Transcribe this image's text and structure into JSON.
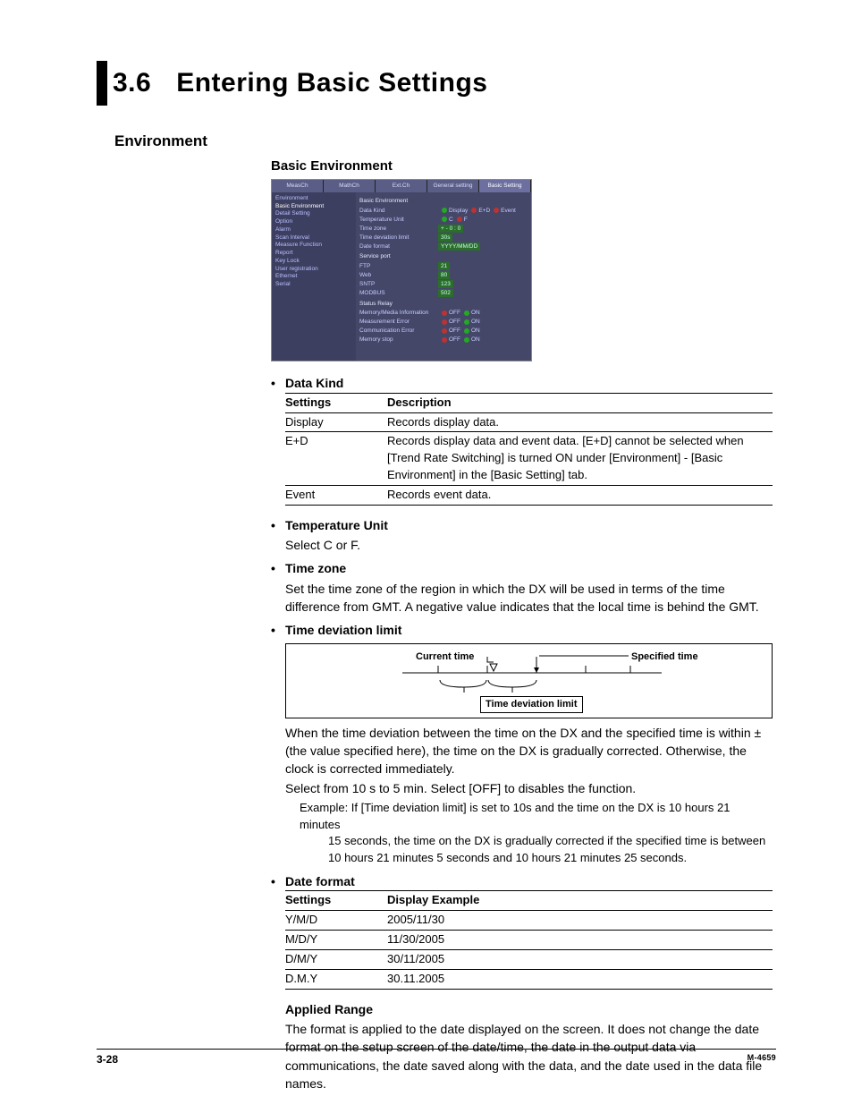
{
  "chapter": {
    "num": "3.6",
    "title": "Entering Basic Settings"
  },
  "h2_env": "Environment",
  "h3_basic_env": "Basic Environment",
  "screenshot": {
    "tabs": [
      "MeasCh",
      "MathCh",
      "Ext.Ch",
      "General setting",
      "Basic Setting"
    ],
    "nav": [
      "Environment",
      "Basic Environment",
      "Detail Setting",
      "Option",
      "Alarm",
      "Scan Interval",
      "Measure Function",
      "Report",
      "Key Lock",
      "User registration",
      "Ethernet",
      "Serial"
    ],
    "panel_title": "Basic Environment",
    "rows_env": [
      {
        "label": "Data Kind",
        "opts": [
          "Display",
          "E+D",
          "Event"
        ]
      },
      {
        "label": "Temperature Unit",
        "opts": [
          "C",
          "F"
        ]
      },
      {
        "label": "Time zone",
        "val": "+  -  0  :  0"
      },
      {
        "label": "Time deviation limit",
        "val": "30s"
      },
      {
        "label": "Date format",
        "val": "YYYY/MM/DD"
      }
    ],
    "section_service": "Service port",
    "rows_service": [
      {
        "label": "FTP",
        "val": "21"
      },
      {
        "label": "Web",
        "val": "80"
      },
      {
        "label": "SNTP",
        "val": "123"
      },
      {
        "label": "MODBUS",
        "val": "502"
      }
    ],
    "section_relay": "Status Relay",
    "rows_relay": [
      {
        "label": "Memory/Media Information",
        "opts": [
          "OFF",
          "ON"
        ]
      },
      {
        "label": "Measurement Error",
        "opts": [
          "OFF",
          "ON"
        ]
      },
      {
        "label": "Communication Error",
        "opts": [
          "OFF",
          "ON"
        ]
      },
      {
        "label": "Memory stop",
        "opts": [
          "OFF",
          "ON"
        ]
      }
    ]
  },
  "bullets": {
    "data_kind": "Data Kind",
    "temp_unit_h": "Temperature Unit",
    "temp_unit_t": "Select C or F.",
    "tz_h": "Time zone",
    "tz_t": "Set the time zone of the region in which the DX will be used in terms of the time difference from GMT.  A negative value indicates that the local time is behind the GMT.",
    "tdl_h": "Time deviation limit",
    "tdl_p1": "When the time deviation between the time on the DX and the specified time is within ±(the value specified here), the time on the DX is gradually corrected.  Otherwise, the clock is corrected immediately.",
    "tdl_p2": "Select from 10 s to 5 min.  Select [OFF] to disables the function.",
    "tdl_ex1": "Example:  If [Time deviation limit] is set to 10s and the time on the DX is 10 hours 21 minutes",
    "tdl_ex2": "15 seconds, the time on the DX is gradually corrected if the specified time is between",
    "tdl_ex3": "10 hours 21 minutes 5 seconds and 10 hours 21 minutes 25 seconds.",
    "df_h": "Date format",
    "ar_h": "Applied Range",
    "ar_t": "The format is applied to the date displayed on the screen.  It does not change the date format on the setup screen of the date/time, the date in the output data via communications, the date saved along with the data, and the date used in the data file names."
  },
  "diagram": {
    "ct": "Current time",
    "st": "Specified time",
    "box": "Time deviation limit"
  },
  "table_dk": {
    "head": [
      "Settings",
      "Description"
    ],
    "rows": [
      [
        "Display",
        "Records display data."
      ],
      [
        "E+D",
        "Records display data and event data.   [E+D] cannot be selected when [Trend Rate Switching] is turned ON under [Environment] - [Basic Environment] in the [Basic Setting] tab."
      ],
      [
        "Event",
        "Records event data."
      ]
    ]
  },
  "table_df": {
    "head": [
      "Settings",
      "Display Example"
    ],
    "rows": [
      [
        "Y/M/D",
        "2005/11/30"
      ],
      [
        "M/D/Y",
        "11/30/2005"
      ],
      [
        "D/M/Y",
        "30/11/2005"
      ],
      [
        "D.M.Y",
        "30.11.2005"
      ]
    ]
  },
  "footer": {
    "page": "3-28",
    "doc": "M-4659"
  }
}
